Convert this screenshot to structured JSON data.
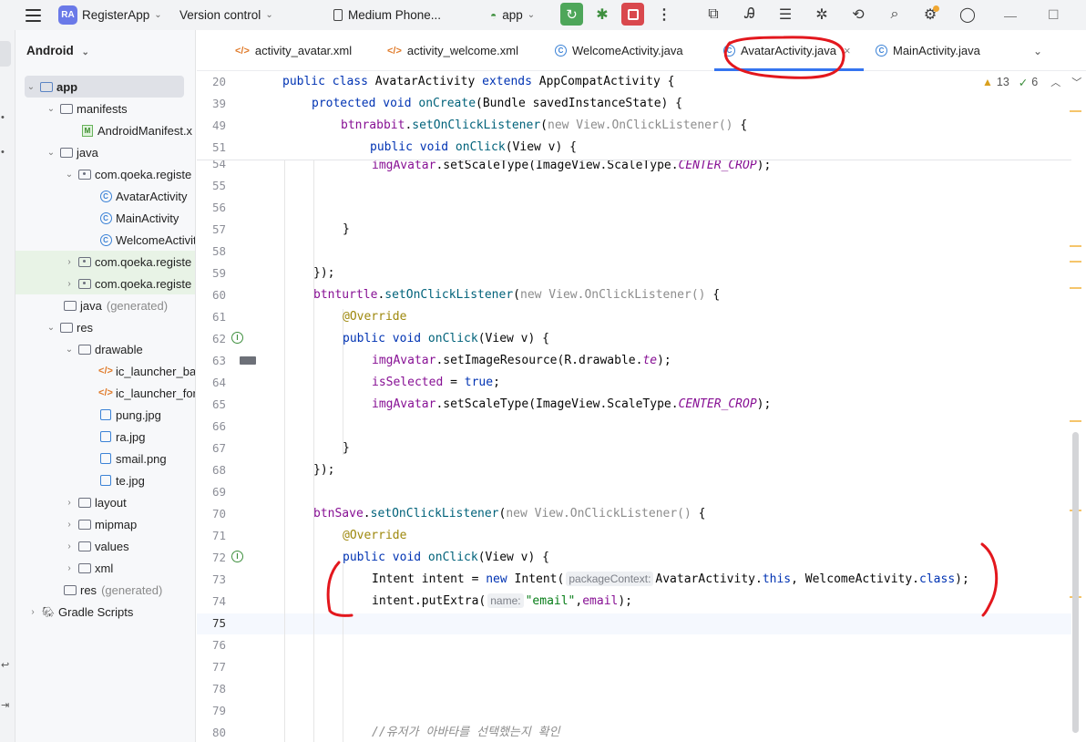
{
  "titlebar": {
    "project_initials": "RA",
    "project_name": "RegisterApp",
    "vcs_label": "Version control",
    "device_label": "Medium Phone...",
    "run_config": "app"
  },
  "project_panel": {
    "view_label": "Android",
    "tree": [
      {
        "label": "app",
        "gen": ""
      },
      {
        "label": "manifests",
        "gen": ""
      },
      {
        "label": "AndroidManifest.x",
        "gen": ""
      },
      {
        "label": "java",
        "gen": ""
      },
      {
        "label": "com.qoeka.registe",
        "gen": ""
      },
      {
        "label": "AvatarActivity",
        "gen": ""
      },
      {
        "label": "MainActivity",
        "gen": ""
      },
      {
        "label": "WelcomeActivit",
        "gen": ""
      },
      {
        "label": "com.qoeka.registe",
        "gen": ""
      },
      {
        "label": "com.qoeka.registe",
        "gen": ""
      },
      {
        "label": "java",
        "gen": "(generated)"
      },
      {
        "label": "res",
        "gen": ""
      },
      {
        "label": "drawable",
        "gen": ""
      },
      {
        "label": "ic_launcher_ba",
        "gen": ""
      },
      {
        "label": "ic_launcher_for",
        "gen": ""
      },
      {
        "label": "pung.jpg",
        "gen": ""
      },
      {
        "label": "ra.jpg",
        "gen": ""
      },
      {
        "label": "smail.png",
        "gen": ""
      },
      {
        "label": "te.jpg",
        "gen": ""
      },
      {
        "label": "layout",
        "gen": ""
      },
      {
        "label": "mipmap",
        "gen": ""
      },
      {
        "label": "values",
        "gen": ""
      },
      {
        "label": "xml",
        "gen": ""
      },
      {
        "label": "res",
        "gen": "(generated)"
      },
      {
        "label": "Gradle Scripts",
        "gen": ""
      }
    ]
  },
  "tabs": [
    {
      "label": "activity_avatar.xml"
    },
    {
      "label": "activity_welcome.xml"
    },
    {
      "label": "WelcomeActivity.java"
    },
    {
      "label": "AvatarActivity.java"
    },
    {
      "label": "MainActivity.java"
    }
  ],
  "inspections": {
    "warnings": "13",
    "ok": "6"
  },
  "editor": {
    "line_numbers": [
      "20",
      "39",
      "49",
      "51",
      "54",
      "55",
      "56",
      "57",
      "58",
      "59",
      "60",
      "61",
      "62",
      "63",
      "64",
      "65",
      "66",
      "67",
      "68",
      "69",
      "70",
      "71",
      "72",
      "73",
      "74",
      "75",
      "76",
      "77",
      "78",
      "79",
      "80"
    ],
    "hints": {
      "package_context": "packageContext:",
      "name": "name:"
    },
    "comment": "//유저가 아바타를 선택했는지 확인"
  }
}
